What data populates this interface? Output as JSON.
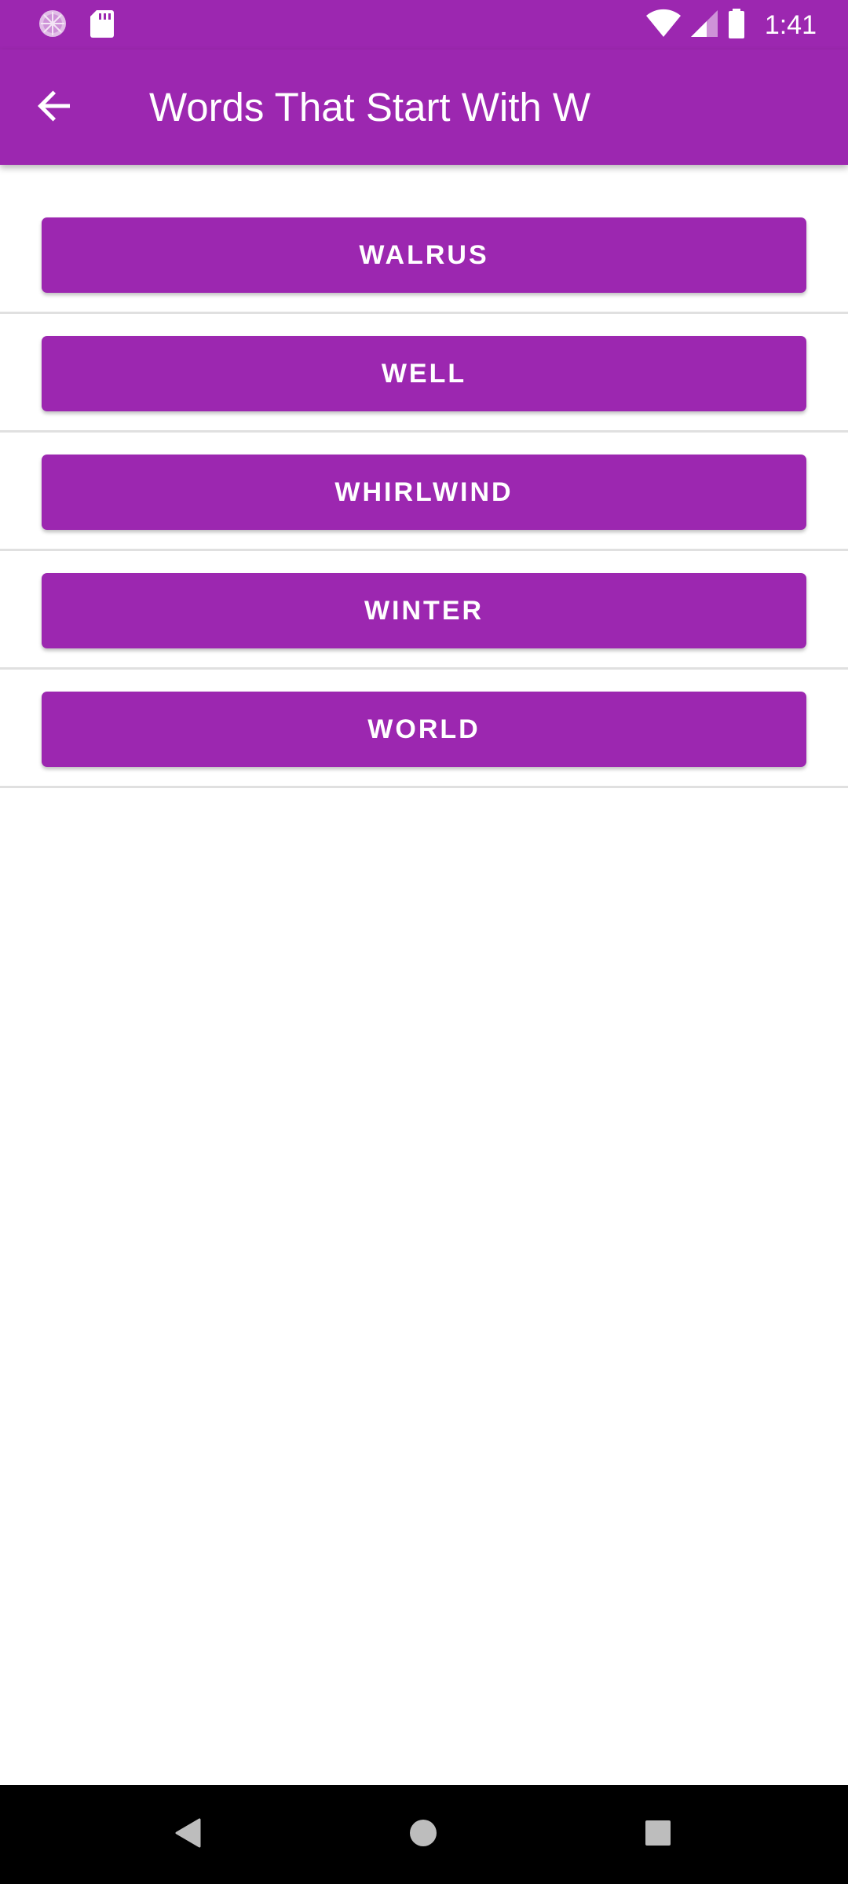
{
  "status_bar": {
    "time": "1:41",
    "icons": [
      "app-notification-icon",
      "sd-card-icon",
      "wifi-icon",
      "cell-signal-icon",
      "battery-icon"
    ]
  },
  "app_bar": {
    "back_icon": "back-arrow-icon",
    "title": "Words That Start With W"
  },
  "words": [
    {
      "label": "WALRUS"
    },
    {
      "label": "WELL"
    },
    {
      "label": "WHIRLWIND"
    },
    {
      "label": "WINTER"
    },
    {
      "label": "WORLD"
    }
  ],
  "nav_bar": {
    "icons": [
      "back-triangle-icon",
      "home-circle-icon",
      "recents-square-icon"
    ]
  },
  "colors": {
    "primary": "#9c27b0",
    "on_primary": "#ffffff",
    "divider": "#e0e0e0",
    "nav_background": "#000000"
  }
}
